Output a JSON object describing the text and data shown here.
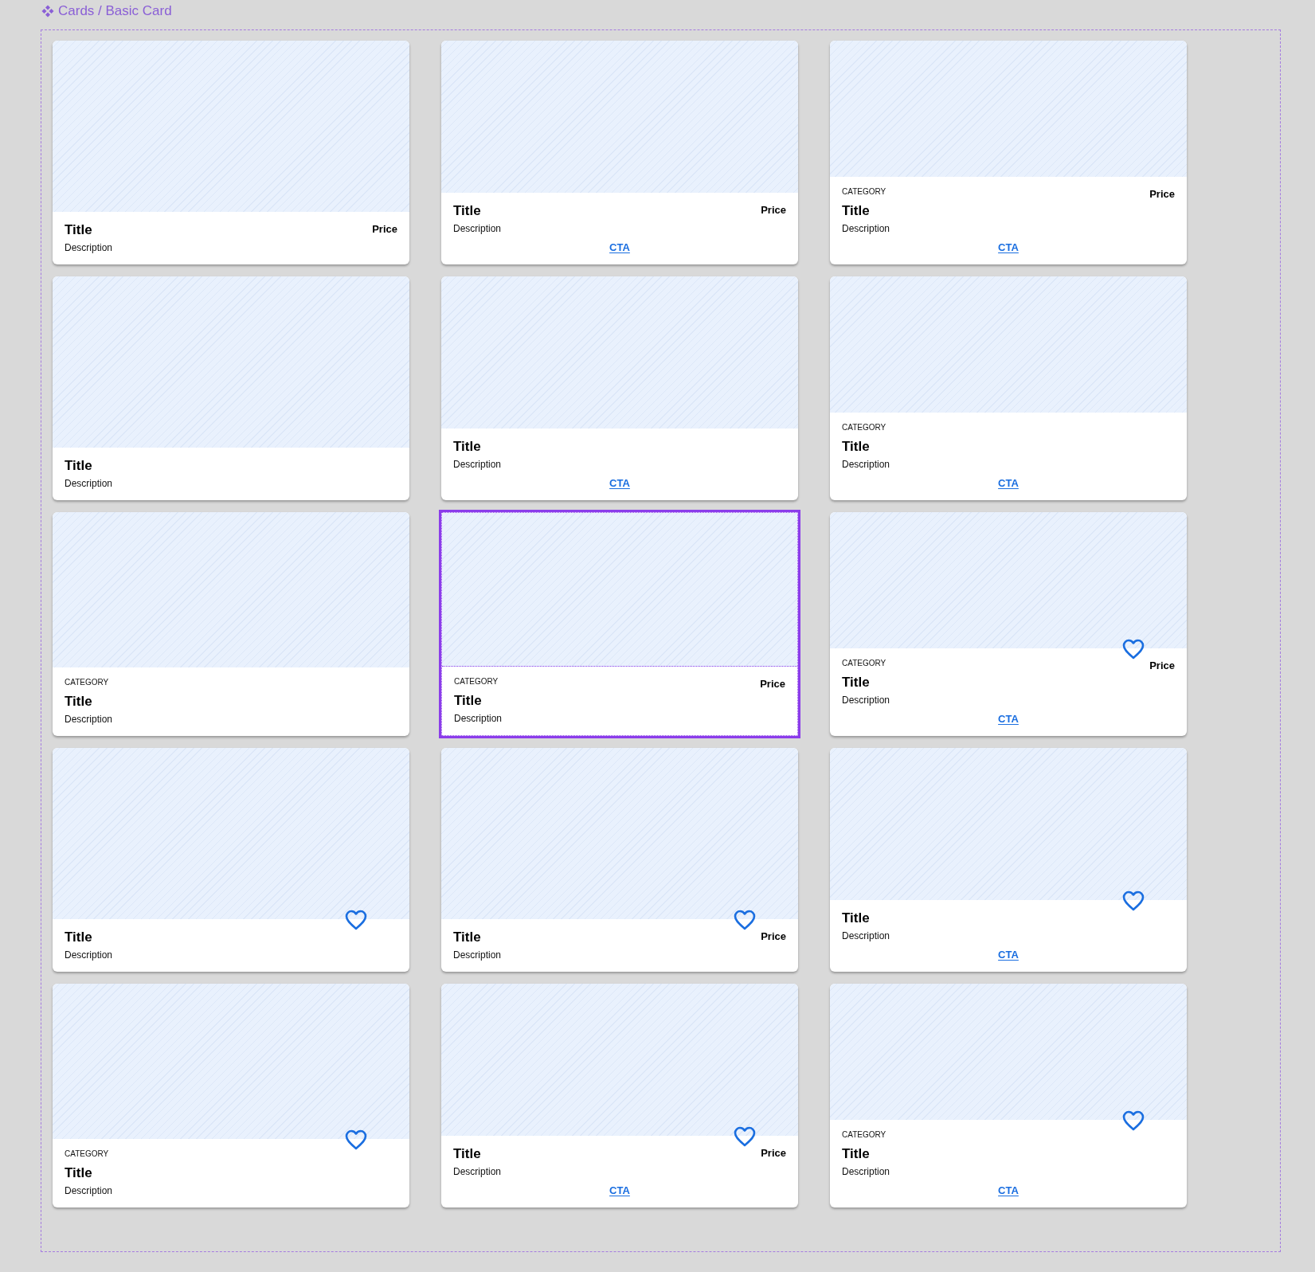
{
  "breadcrumb": "Cards / Basic Card",
  "cards": [
    {
      "title": "Title",
      "description": "Description",
      "price": "Price",
      "favorite_icon": false,
      "selected": false
    },
    {
      "title": "Title",
      "description": "Description",
      "price": "Price",
      "cta": "CTA",
      "favorite_icon": false,
      "selected": false
    },
    {
      "category": "CATEGORY",
      "title": "Title",
      "description": "Description",
      "price": "Price",
      "cta": "CTA",
      "favorite_icon": false,
      "selected": false
    },
    {
      "title": "Title",
      "description": "Description",
      "favorite_icon": false,
      "selected": false
    },
    {
      "title": "Title",
      "description": "Description",
      "cta": "CTA",
      "favorite_icon": false,
      "selected": false
    },
    {
      "category": "CATEGORY",
      "title": "Title",
      "description": "Description",
      "cta": "CTA",
      "favorite_icon": false,
      "selected": false
    },
    {
      "category": "CATEGORY",
      "title": "Title",
      "description": "Description",
      "favorite_icon": false,
      "selected": false
    },
    {
      "category": "CATEGORY",
      "title": "Title",
      "description": "Description",
      "price": "Price",
      "favorite_icon": false,
      "selected": true
    },
    {
      "category": "CATEGORY",
      "title": "Title",
      "description": "Description",
      "price": "Price",
      "cta": "CTA",
      "favorite_icon": true,
      "selected": false
    },
    {
      "title": "Title",
      "description": "Description",
      "favorite_icon": true,
      "selected": false
    },
    {
      "title": "Title",
      "description": "Description",
      "price": "Price",
      "favorite_icon": true,
      "selected": false
    },
    {
      "title": "Title",
      "description": "Description",
      "cta": "CTA",
      "favorite_icon": true,
      "selected": false
    },
    {
      "category": "CATEGORY",
      "title": "Title",
      "description": "Description",
      "favorite_icon": true,
      "selected": false
    },
    {
      "title": "Title",
      "description": "Description",
      "price": "Price",
      "cta": "CTA",
      "favorite_icon": true,
      "selected": false
    },
    {
      "category": "CATEGORY",
      "title": "Title",
      "description": "Description",
      "cta": "CTA",
      "favorite_icon": true,
      "selected": false
    }
  ]
}
